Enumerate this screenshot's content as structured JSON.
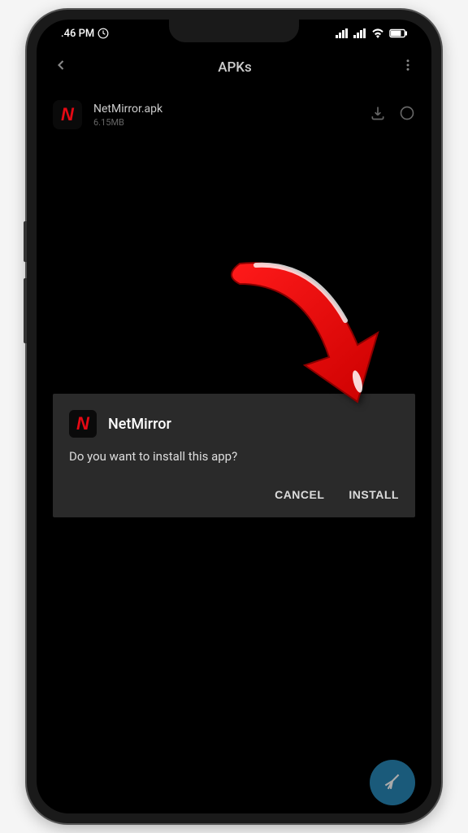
{
  "statusBar": {
    "time": ".46 PM",
    "timeIcon": "⊙"
  },
  "header": {
    "title": "APKs"
  },
  "fileItem": {
    "name": "NetMirror.apk",
    "size": "6.15MB",
    "iconLetter": "N"
  },
  "dialog": {
    "iconLetter": "N",
    "title": "NetMirror",
    "message": "Do you want to install this app?",
    "cancelLabel": "CANCEL",
    "installLabel": "INSTALL"
  }
}
